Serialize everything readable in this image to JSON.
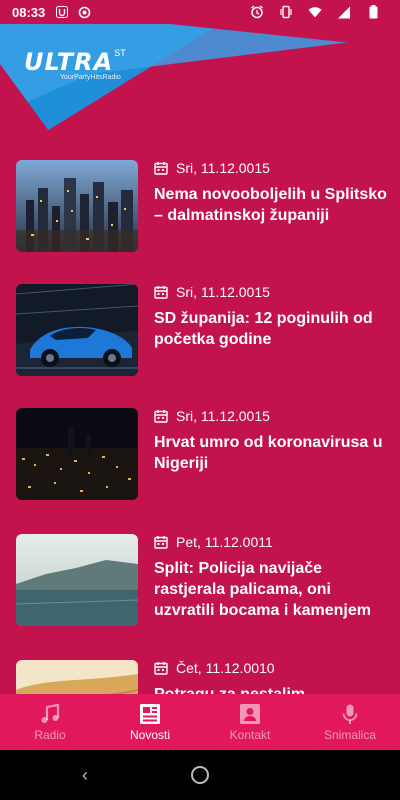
{
  "status_bar": {
    "time": "08:33"
  },
  "logo": {
    "word": "ULTRA",
    "superscript": "ST",
    "tagline": "YourPartyHitsRadio"
  },
  "articles": [
    {
      "date": "Sri, 11.12.0015",
      "title": "Nema novooboljelih u Splitsko – dalmatinskoj županiji"
    },
    {
      "date": "Sri, 11.12.0015",
      "title": "SD županija: 12 poginulih od početka godine"
    },
    {
      "date": "Sri, 11.12.0015",
      "title": "Hrvat umro od koronavirusa u Nigeriji"
    },
    {
      "date": "Pet, 11.12.0011",
      "title": "Split: Policija navijače rastjerala palicama, oni uzvratili bocama i kamenjem"
    },
    {
      "date": "Čet, 11.12.0010",
      "title": "Potragu za nestalim"
    }
  ],
  "nav": {
    "radio": "Radio",
    "novosti": "Novosti",
    "kontakt": "Kontakt",
    "snimalica": "Snimalica"
  },
  "colors": {
    "background": "#c2134d",
    "nav_background": "#e2185d",
    "header_blue": "#1e8fd8"
  }
}
